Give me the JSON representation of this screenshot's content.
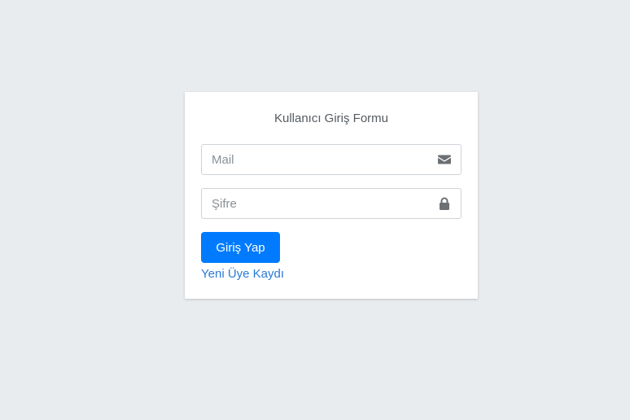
{
  "form": {
    "title": "Kullanıcı Giriş Formu",
    "mail": {
      "placeholder": "Mail",
      "value": "",
      "icon": "envelope-icon"
    },
    "password": {
      "placeholder": "Şifre",
      "value": "",
      "icon": "lock-icon"
    },
    "submit_label": "Giriş Yap",
    "register_link": "Yeni Üye Kaydı"
  },
  "colors": {
    "background": "#e9ecef",
    "card": "#ffffff",
    "primary": "#007bff",
    "link": "#2a7ad8",
    "icon": "#6c6f73"
  }
}
